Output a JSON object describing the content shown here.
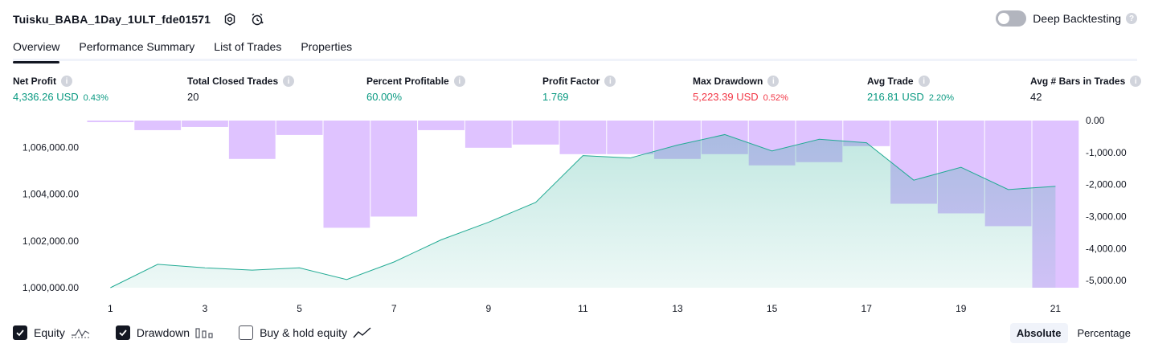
{
  "header": {
    "strategy_name": "Tuisku_BABA_1Day_1ULT_fde01571",
    "deep_backtesting_label": "Deep Backtesting",
    "deep_backtesting_on": false
  },
  "tabs": [
    {
      "label": "Overview",
      "active": true
    },
    {
      "label": "Performance Summary",
      "active": false
    },
    {
      "label": "List of Trades",
      "active": false
    },
    {
      "label": "Properties",
      "active": false
    }
  ],
  "metrics": {
    "net_profit": {
      "label": "Net Profit",
      "value": "4,336.26 USD",
      "pct": "0.43%"
    },
    "total_closed_trades": {
      "label": "Total Closed Trades",
      "value": "20"
    },
    "percent_profitable": {
      "label": "Percent Profitable",
      "value": "60.00%"
    },
    "profit_factor": {
      "label": "Profit Factor",
      "value": "1.769"
    },
    "max_drawdown": {
      "label": "Max Drawdown",
      "value": "5,223.39 USD",
      "pct": "0.52%"
    },
    "avg_trade": {
      "label": "Avg Trade",
      "value": "216.81 USD",
      "pct": "2.20%"
    },
    "avg_bars": {
      "label": "Avg # Bars in Trades",
      "value": "42"
    }
  },
  "legend": {
    "equity": {
      "label": "Equity",
      "checked": true
    },
    "drawdown": {
      "label": "Drawdown",
      "checked": true
    },
    "buy_hold": {
      "label": "Buy & hold equity",
      "checked": false
    }
  },
  "mode": {
    "absolute": "Absolute",
    "percentage": "Percentage",
    "selected": "Absolute"
  },
  "colors": {
    "equity_line": "#22ab94",
    "drawdown_fill": "#d9b8ff",
    "positive": "#089981",
    "negative": "#f23645"
  },
  "chart_data": {
    "type": "area",
    "x": [
      1,
      2,
      3,
      4,
      5,
      6,
      7,
      8,
      9,
      10,
      11,
      12,
      13,
      14,
      15,
      16,
      17,
      18,
      19,
      20,
      21
    ],
    "x_ticks": [
      "1",
      "3",
      "5",
      "7",
      "9",
      "11",
      "13",
      "15",
      "17",
      "19",
      "21"
    ],
    "series": [
      {
        "name": "Equity",
        "type": "area",
        "axis": "left",
        "values": [
          1000000,
          1001000,
          1000850,
          1000750,
          1000850,
          1000350,
          1001100,
          1002050,
          1002800,
          1003650,
          1005650,
          1005550,
          1006100,
          1006550,
          1005850,
          1006350,
          1006200,
          1004600,
          1005150,
          1004200,
          1004336
        ]
      },
      {
        "name": "Drawdown",
        "type": "bar",
        "axis": "right",
        "values": [
          -50,
          -300,
          -200,
          -1200,
          -450,
          -3350,
          -3000,
          -300,
          -850,
          -750,
          -1050,
          -1050,
          -1200,
          -1050,
          -1400,
          -1300,
          -800,
          -2600,
          -2900,
          -3300,
          -5223
        ]
      }
    ],
    "y_left": {
      "ticks": [
        "1,000,000.00",
        "1,002,000.00",
        "1,004,000.00",
        "1,006,000.00"
      ],
      "range": [
        1000000,
        1007150
      ]
    },
    "y_right": {
      "ticks": [
        "0.00",
        "-1,000.00",
        "-2,000.00",
        "-3,000.00",
        "-4,000.00",
        "-5,000.00"
      ],
      "range": [
        -5223,
        0
      ]
    },
    "grid": false
  }
}
